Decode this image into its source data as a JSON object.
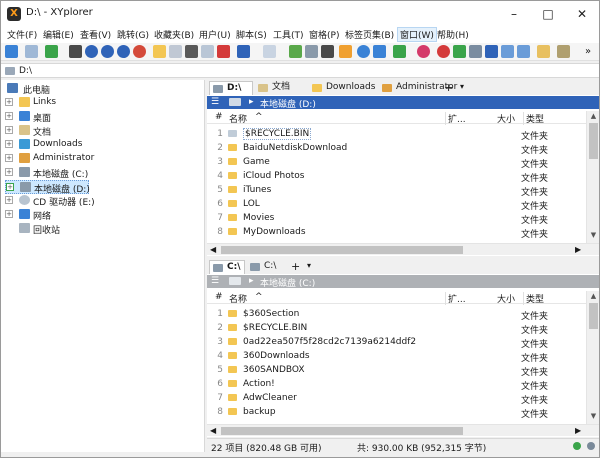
{
  "window": {
    "title": "D:\\ - XYplorer",
    "app_icon": "X"
  },
  "menu": [
    "文件(F)",
    "编辑(E)",
    "查看(V)",
    "跳转(G)",
    "收藏夹(B)",
    "用户(U)",
    "脚本(S)",
    "工具(T)",
    "窗格(P)",
    "标签页集(B)",
    "窗口(W)",
    "帮助(H)"
  ],
  "address": {
    "path": "D:\\"
  },
  "tree": [
    {
      "label": "此电脑",
      "icon": "computer-icon"
    },
    {
      "label": "Links",
      "icon": "folder-icon"
    },
    {
      "label": "桌面",
      "icon": "desktop-icon"
    },
    {
      "label": "文档",
      "icon": "documents-icon"
    },
    {
      "label": "Downloads",
      "icon": "downloads-icon"
    },
    {
      "label": "Administrator",
      "icon": "user-folder-icon"
    },
    {
      "label": "本地磁盘 (C:)",
      "icon": "drive-icon"
    },
    {
      "label": "本地磁盘 (D:)",
      "icon": "drive-icon"
    },
    {
      "label": "CD 驱动器 (E:)",
      "icon": "cd-drive-icon"
    },
    {
      "label": "网络",
      "icon": "network-icon"
    },
    {
      "label": "回收站",
      "icon": "recycle-bin-icon"
    }
  ],
  "pane1": {
    "tabs": [
      "D:\\",
      "文档",
      "Downloads",
      "Administrator"
    ],
    "add_tab": "+",
    "tab_menu": "▾",
    "breadcrumb": "本地磁盘 (D:)",
    "columns": {
      "num": "#",
      "name": "名称",
      "ext": "扩...",
      "size": "大小",
      "type": "类型"
    },
    "rows": [
      {
        "num": "1",
        "name": "$RECYCLE.BIN",
        "type": "文件夹"
      },
      {
        "num": "2",
        "name": "BaiduNetdiskDownload",
        "type": "文件夹"
      },
      {
        "num": "3",
        "name": "Game",
        "type": "文件夹"
      },
      {
        "num": "4",
        "name": "iCloud Photos",
        "type": "文件夹"
      },
      {
        "num": "5",
        "name": "iTunes",
        "type": "文件夹"
      },
      {
        "num": "6",
        "name": "LOL",
        "type": "文件夹"
      },
      {
        "num": "7",
        "name": "Movies",
        "type": "文件夹"
      },
      {
        "num": "8",
        "name": "MyDownloads",
        "type": "文件夹"
      }
    ]
  },
  "pane2": {
    "tabs": [
      "C:\\",
      "C:\\"
    ],
    "add_tab": "+",
    "tab_menu": "▾",
    "breadcrumb": "本地磁盘 (C:)",
    "columns": {
      "num": "#",
      "name": "名称",
      "ext": "扩...",
      "size": "大小",
      "type": "类型"
    },
    "rows": [
      {
        "num": "1",
        "name": "$360Section",
        "type": "文件夹"
      },
      {
        "num": "2",
        "name": "$RECYCLE.BIN",
        "type": "文件夹"
      },
      {
        "num": "3",
        "name": "0ad22ea507f5f28cd2c7139a6214ddf2",
        "type": "文件夹"
      },
      {
        "num": "4",
        "name": "360Downloads",
        "type": "文件夹"
      },
      {
        "num": "5",
        "name": "360SANDBOX",
        "type": "文件夹"
      },
      {
        "num": "6",
        "name": "Action!",
        "type": "文件夹"
      },
      {
        "num": "7",
        "name": "AdwCleaner",
        "type": "文件夹"
      },
      {
        "num": "8",
        "name": "backup",
        "type": "文件夹"
      }
    ]
  },
  "status": {
    "left": "22 项目 (820.48 GB 可用)",
    "right": "共: 930.00 KB (952,315 字节)"
  },
  "colors": {
    "active_crumb": "#2f63b8",
    "inactive_crumb": "#aeb1b5",
    "folder": "#f3c653",
    "selected": "#cde8ff"
  }
}
